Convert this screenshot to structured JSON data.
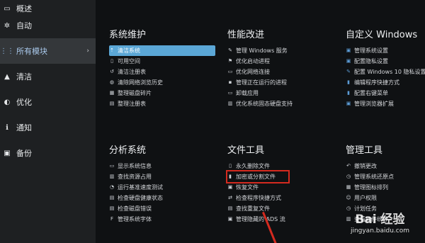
{
  "sidebar": {
    "items": [
      {
        "label": "概述",
        "icon": "monitor-icon",
        "glyph": "▭"
      },
      {
        "label": "自动",
        "icon": "gears-icon",
        "glyph": "✲"
      },
      {
        "label": "所有模块",
        "icon": "grid-icon",
        "glyph": "⋮⋮",
        "active": true,
        "chevron": "›"
      },
      {
        "label": "清洁",
        "icon": "broom-icon",
        "glyph": "▲"
      },
      {
        "label": "优化",
        "icon": "speed-icon",
        "glyph": "◐"
      },
      {
        "label": "通知",
        "icon": "info-icon",
        "glyph": "ℹ"
      },
      {
        "label": "备份",
        "icon": "backup-icon",
        "glyph": "▣"
      }
    ]
  },
  "modules": {
    "maintenance": {
      "title": "系统维护",
      "items": [
        {
          "label": "清洁系统",
          "icon": "broom-icon",
          "glyph": "⇡",
          "highlight": true
        },
        {
          "label": "可用空间",
          "icon": "disk-icon",
          "glyph": "▯"
        },
        {
          "label": "清洁注册表",
          "icon": "registry-icon",
          "glyph": "↺"
        },
        {
          "label": "清除网络浏览历史",
          "icon": "globe-icon",
          "glyph": "◍"
        },
        {
          "label": "整理磁盘碎片",
          "icon": "defrag-icon",
          "glyph": "▦"
        },
        {
          "label": "整理注册表",
          "icon": "registry-defrag-icon",
          "glyph": "▤"
        }
      ]
    },
    "performance": {
      "title": "性能改进",
      "items": [
        {
          "label": "管理 Windows 服务",
          "icon": "wrench-icon",
          "glyph": "✎"
        },
        {
          "label": "优化启动进程",
          "icon": "flag-icon",
          "glyph": "⚑"
        },
        {
          "label": "优化网络连接",
          "icon": "network-icon",
          "glyph": "▭"
        },
        {
          "label": "管理正在运行的进程",
          "icon": "process-icon",
          "glyph": "▪"
        },
        {
          "label": "卸载应用",
          "icon": "uninstall-icon",
          "glyph": "▭"
        },
        {
          "label": "优化系统固态硬盘支持",
          "icon": "ssd-icon",
          "glyph": "▥"
        }
      ]
    },
    "custom": {
      "title": "自定义 Windows",
      "items": [
        {
          "label": "管理系统设置",
          "icon": "settings-icon",
          "glyph": "▣",
          "blue": true
        },
        {
          "label": "配置隐私设置",
          "icon": "privacy-icon",
          "glyph": "▣",
          "blue": true
        },
        {
          "label": "配置 Windows 10 隐私设置",
          "icon": "privacy-win10-icon",
          "glyph": "✎",
          "blue": true
        },
        {
          "label": "编辑程序快捷方式",
          "icon": "shortcut-icon",
          "glyph": "▮",
          "blue": true
        },
        {
          "label": "配置右键菜单",
          "icon": "context-menu-icon",
          "glyph": "▮",
          "blue": true
        },
        {
          "label": "管理浏览器扩展",
          "icon": "extension-icon",
          "glyph": "▣",
          "blue": true
        }
      ]
    },
    "analysis": {
      "title": "分析系统",
      "items": [
        {
          "label": "显示系统信息",
          "icon": "monitor-icon",
          "glyph": "▭"
        },
        {
          "label": "查找资源占用",
          "icon": "chart-icon",
          "glyph": "▥"
        },
        {
          "label": "运行基准速度测试",
          "icon": "gauge-icon",
          "glyph": "◔"
        },
        {
          "label": "检查硬盘健康状态",
          "icon": "disk-health-icon",
          "glyph": "▤"
        },
        {
          "label": "检查磁盘错误",
          "icon": "disk-check-icon",
          "glyph": "▤"
        },
        {
          "label": "管理系统字体",
          "icon": "font-icon",
          "glyph": "F"
        }
      ]
    },
    "files": {
      "title": "文件工具",
      "items": [
        {
          "label": "永久删除文件",
          "icon": "shred-icon",
          "glyph": "▯"
        },
        {
          "label": "加密或分割文件",
          "icon": "encrypt-icon",
          "glyph": "▮",
          "boxed": true
        },
        {
          "label": "恢复文件",
          "icon": "restore-icon",
          "glyph": "▣"
        },
        {
          "label": "检查程序快捷方式",
          "icon": "shortcut-check-icon",
          "glyph": "⇄"
        },
        {
          "label": "查找重复文件",
          "icon": "duplicate-icon",
          "glyph": "▤"
        },
        {
          "label": "管理隐藏的 ADS 流",
          "icon": "ads-icon",
          "glyph": "▣"
        }
      ]
    },
    "admin": {
      "title": "管理工具",
      "items": [
        {
          "label": "撤销更改",
          "icon": "undo-icon",
          "glyph": "↶"
        },
        {
          "label": "管理系统还原点",
          "icon": "restore-point-icon",
          "glyph": "◷"
        },
        {
          "label": "管理图标排列",
          "icon": "icon-layout-icon",
          "glyph": "▦"
        },
        {
          "label": "用户权限",
          "icon": "user-icon",
          "glyph": "☺"
        },
        {
          "label": "计划任务",
          "icon": "task-icon",
          "glyph": "◷"
        },
        {
          "label": "查看软件统计",
          "icon": "stats-icon",
          "glyph": "▥"
        }
      ]
    }
  },
  "watermark": {
    "logo": "Bai  经验",
    "url": "jingyan.baidu.com"
  },
  "colors": {
    "sidebar_bg": "#1e2022",
    "main_bg": "#0f1113",
    "active_bg": "#34373a",
    "highlight": "#5ba7d6",
    "annotation_red": "#d42a1f"
  }
}
